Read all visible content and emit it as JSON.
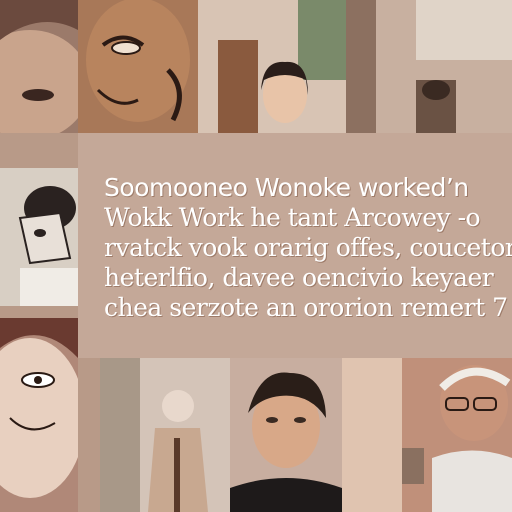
{
  "caption": {
    "lines": [
      "Soomooneo Wonoke worked’n",
      "Wokk Work he tant Arcowey -o",
      "rvatck vook orarig offes, coucetor",
      "heterlfio, davee oencivio keyaer",
      "chea serzote an ororion remert 7"
    ]
  },
  "colors": {
    "background": "#b89a88",
    "panel": "#c4a898",
    "text": "#ffffff"
  }
}
